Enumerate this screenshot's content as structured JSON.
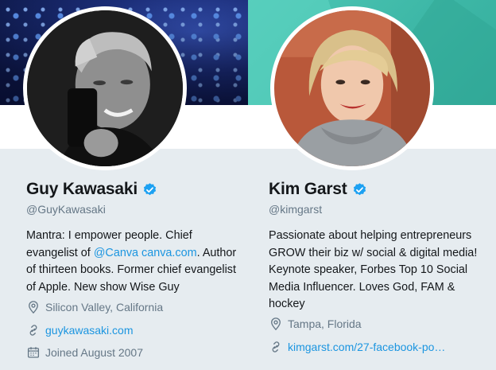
{
  "profiles": [
    {
      "name": "Guy Kawasaki",
      "handle": "@GuyKawasaki",
      "bio_line1": "Mantra: I empower people. Chief",
      "bio_line2_pre": "evangelist of ",
      "bio_line2_mention": "@Canva",
      "bio_line2_space": " ",
      "bio_line2_url": "canva.com",
      "bio_line2_post": ". Author",
      "bio_line3": "of thirteen books. Former chief evangelist",
      "bio_line4": "of Apple. New show Wise Guy",
      "location": "Silicon Valley, California",
      "url": "guykawasaki.com",
      "joined": "Joined August 2007"
    },
    {
      "name": "Kim Garst",
      "handle": "@kimgarst",
      "bio_lines": [
        "Passionate about helping entrepreneurs",
        "GROW their biz w/ social & digital media!",
        "Keynote speaker, Forbes Top 10 Social",
        "Media Influencer. Loves God, FAM &",
        "hockey"
      ],
      "location": "Tampa, Florida",
      "url": "kimgarst.com/27-facebook-po…"
    }
  ],
  "colors": {
    "link": "#1b95e0",
    "verified": "#1da1f2",
    "muted": "#657786",
    "text": "#14171a",
    "card_bg": "#e6ecf0"
  },
  "icons": [
    "verified-badge-icon",
    "location-pin-icon",
    "link-icon",
    "calendar-icon"
  ]
}
